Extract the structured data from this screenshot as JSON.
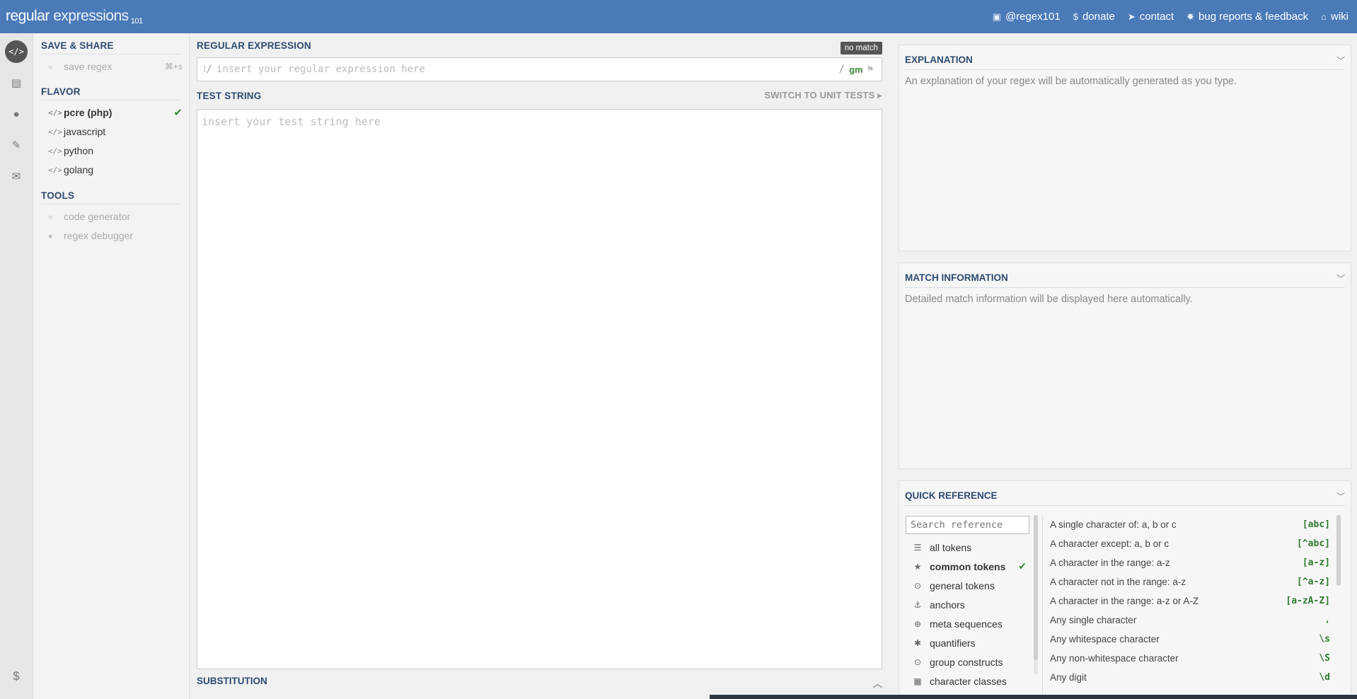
{
  "header": {
    "logo_main": "regular",
    "logo_second": " expressions",
    "logo_sup": "101",
    "links": [
      {
        "icon": "twitter-icon",
        "glyph": "▣",
        "label": "@regex101"
      },
      {
        "icon": "dollar-icon",
        "glyph": "$",
        "label": "donate"
      },
      {
        "icon": "paper-plane-icon",
        "glyph": "➤",
        "label": "contact"
      },
      {
        "icon": "bug-icon",
        "glyph": "✸",
        "label": "bug reports & feedback"
      },
      {
        "icon": "bank-icon",
        "glyph": "⌂",
        "label": "wiki"
      }
    ]
  },
  "rail": {
    "icons": [
      {
        "name": "code-icon",
        "glyph": "</>"
      },
      {
        "name": "book-icon",
        "glyph": "▤"
      },
      {
        "name": "user-icon",
        "glyph": "●"
      },
      {
        "name": "wrench-icon",
        "glyph": "✎"
      },
      {
        "name": "chat-icon",
        "glyph": "✉"
      }
    ],
    "bottom_glyph": "$"
  },
  "sidebar": {
    "save_share_title": "SAVE & SHARE",
    "save_regex": {
      "label": "save regex",
      "shortcut": "⌘+s"
    },
    "flavor_title": "FLAVOR",
    "flavors": [
      {
        "label": "pcre (php)",
        "selected": true
      },
      {
        "label": "javascript"
      },
      {
        "label": "python"
      },
      {
        "label": "golang"
      }
    ],
    "tools_title": "TOOLS",
    "tools": [
      {
        "label": "code generator"
      },
      {
        "label": "regex debugger"
      }
    ]
  },
  "editor": {
    "regex_title": "REGULAR EXPRESSION",
    "no_match": "no match",
    "regex_open": "⁝/",
    "regex_placeholder": "insert your regular expression here",
    "regex_close": "/",
    "flags": "gm",
    "test_title": "TEST STRING",
    "switch_label": "SWITCH TO UNIT TESTS ▸",
    "test_placeholder": "insert your test string here",
    "substitution_title": "SUBSTITUTION",
    "substitution_chevron": "︿"
  },
  "explanation": {
    "title": "EXPLANATION",
    "text": "An explanation of your regex will be automatically generated as you type."
  },
  "match_info": {
    "title": "MATCH INFORMATION",
    "text": "Detailed match information will be displayed here automatically."
  },
  "quick_ref": {
    "title": "QUICK REFERENCE",
    "search_placeholder": "Search reference",
    "categories": [
      {
        "label": "all tokens",
        "icon": "database-icon",
        "glyph": "☰"
      },
      {
        "label": "common tokens",
        "icon": "star-icon",
        "glyph": "★",
        "selected": true
      },
      {
        "label": "general tokens",
        "icon": "circle-dot-icon",
        "glyph": "⊙"
      },
      {
        "label": "anchors",
        "icon": "anchor-icon",
        "glyph": "⚓"
      },
      {
        "label": "meta sequences",
        "icon": "globe-icon",
        "glyph": "⊕"
      },
      {
        "label": "quantifiers",
        "icon": "asterisk-icon",
        "glyph": "✱"
      },
      {
        "label": "group constructs",
        "icon": "circle-dot-icon",
        "glyph": "⊙"
      },
      {
        "label": "character classes",
        "icon": "grid-icon",
        "glyph": "▦"
      }
    ],
    "rows": [
      {
        "desc": "A single character of: a, b or c",
        "token": "[abc]"
      },
      {
        "desc": "A character except: a, b or c",
        "token": "[^abc]"
      },
      {
        "desc": "A character in the range: a-z",
        "token": "[a-z]"
      },
      {
        "desc": "A character not in the range: a-z",
        "token": "[^a-z]"
      },
      {
        "desc": "A character in the range: a-z or A-Z",
        "token": "[a-zA-Z]"
      },
      {
        "desc": "Any single character",
        "token": "."
      },
      {
        "desc": "Any whitespace character",
        "token": "\\s"
      },
      {
        "desc": "Any non-whitespace character",
        "token": "\\S"
      },
      {
        "desc": "Any digit",
        "token": "\\d"
      }
    ]
  }
}
